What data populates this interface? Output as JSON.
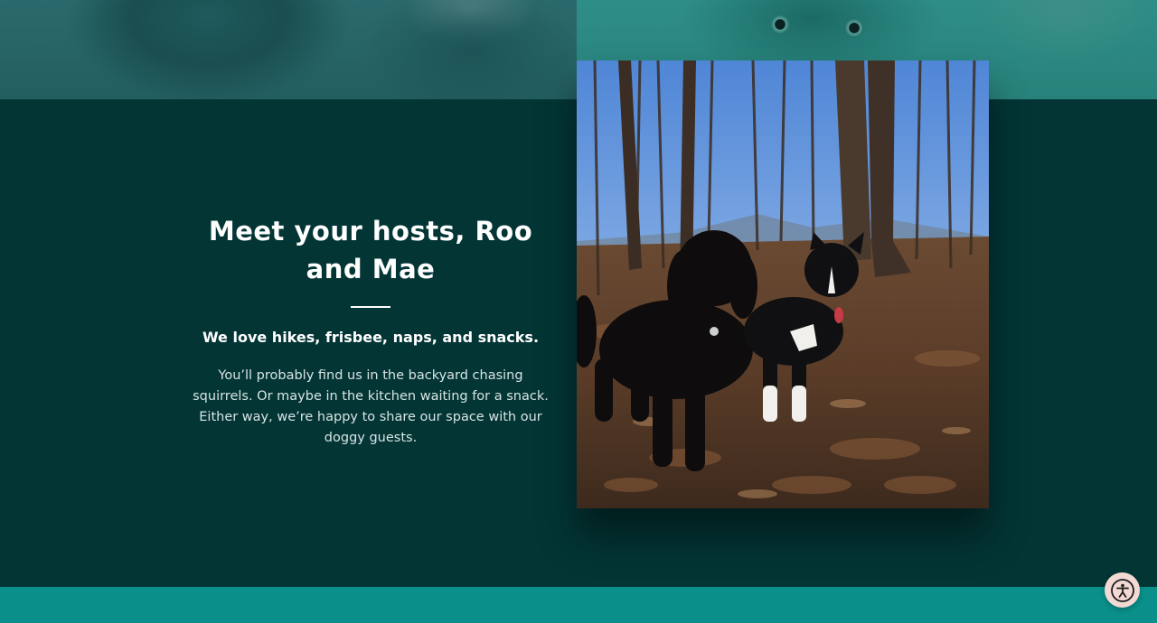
{
  "hosts_section": {
    "heading": "Meet your hosts, Roo and Mae",
    "subheading": "We love hikes, frisbee, naps, and snacks.",
    "body": "You’ll probably find us in the backyard chasing squirrels. Or maybe in the kitchen waiting for a snack. Either way, we’re happy to share our space with our doggy guests."
  },
  "colors": {
    "section_background": "#033535",
    "banner_teal": "#2b6a6c",
    "bottom_band": "#0a8f8a",
    "accessibility_button": "#f3d9d3"
  },
  "icons": {
    "accessibility": "accessibility-icon"
  }
}
